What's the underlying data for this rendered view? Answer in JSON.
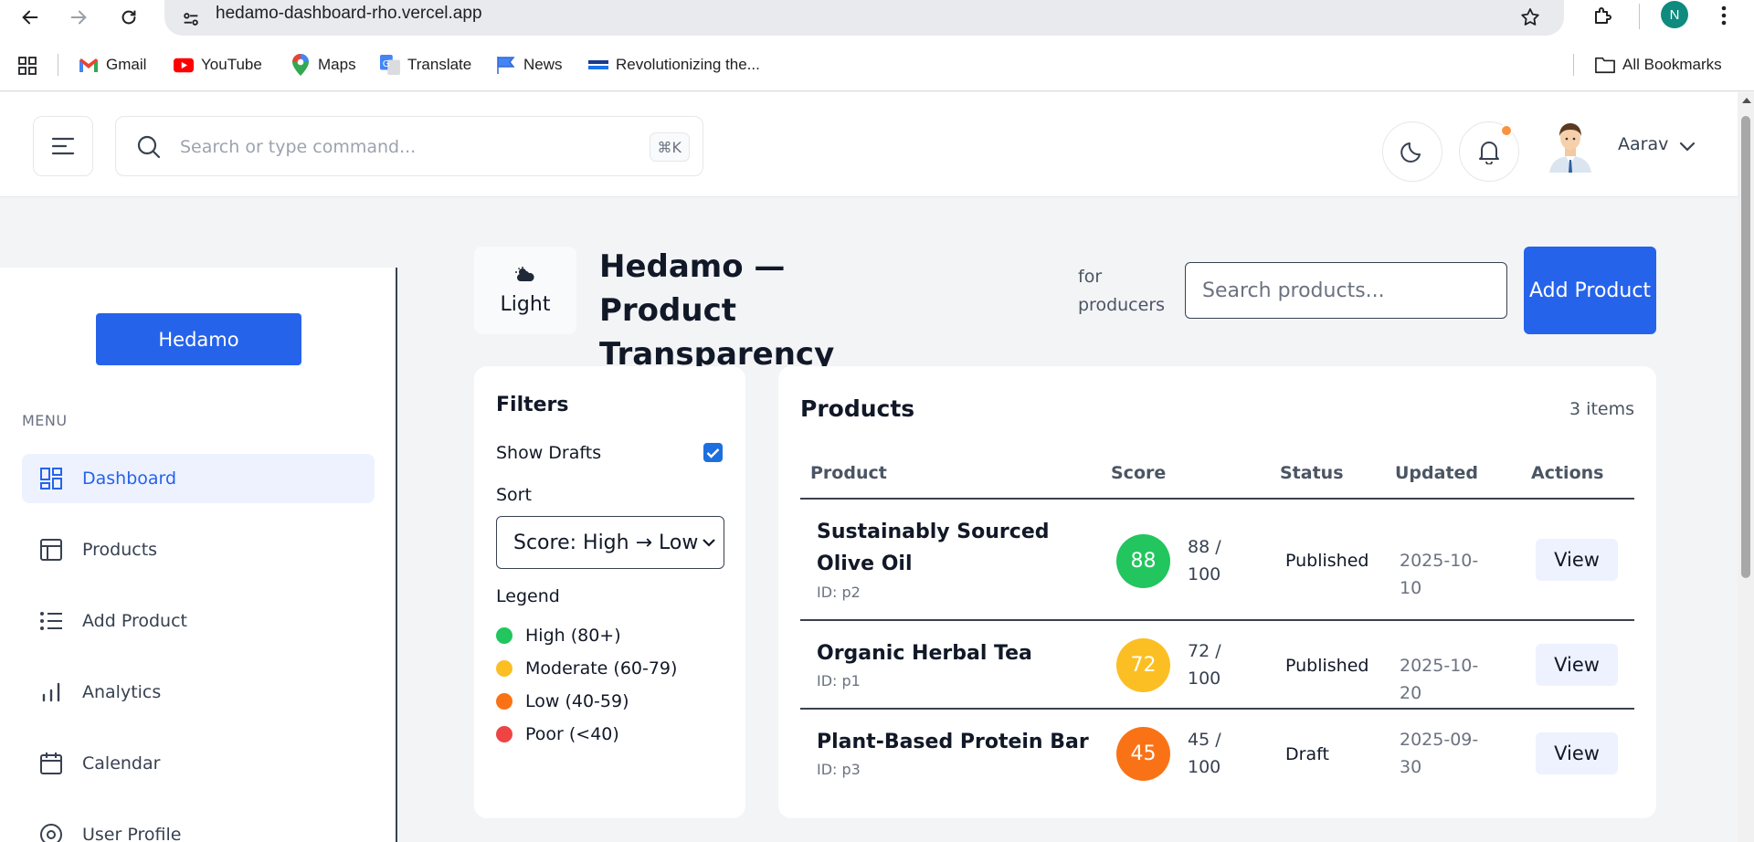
{
  "browser": {
    "url": "hedamo-dashboard-rho.vercel.app",
    "profile_initial": "N",
    "bookmarks": [
      {
        "label": "Gmail",
        "icon": "gmail-icon"
      },
      {
        "label": "YouTube",
        "icon": "youtube-icon"
      },
      {
        "label": "Maps",
        "icon": "maps-icon"
      },
      {
        "label": "Translate",
        "icon": "translate-icon"
      },
      {
        "label": "News",
        "icon": "news-icon"
      },
      {
        "label": "Revolutionizing the...",
        "icon": "site-icon"
      }
    ],
    "all_bookmarks": "All Bookmarks"
  },
  "header": {
    "search_placeholder": "Search or type command...",
    "shortcut": "⌘K",
    "user_name": "Aarav"
  },
  "sidebar": {
    "brand": "Hedamo",
    "menu_label": "MENU",
    "items": [
      {
        "label": "Dashboard",
        "icon": "dashboard-icon",
        "active": true
      },
      {
        "label": "Products",
        "icon": "products-icon"
      },
      {
        "label": "Add Product",
        "icon": "list-icon"
      },
      {
        "label": "Analytics",
        "icon": "analytics-icon"
      },
      {
        "label": "Calendar",
        "icon": "calendar-icon"
      },
      {
        "label": "User Profile",
        "icon": "user-profile-icon"
      }
    ]
  },
  "main": {
    "theme_toggle_label": "Light",
    "title": "Hedamo — Product Transparency",
    "subtitle": "for producers",
    "search_placeholder": "Search products...",
    "add_product_label": "Add Product"
  },
  "filters": {
    "title": "Filters",
    "show_drafts_label": "Show Drafts",
    "show_drafts_checked": true,
    "sort_label": "Sort",
    "sort_value": "Score: High → Low",
    "legend_label": "Legend",
    "legend": [
      {
        "label": "High (80+)",
        "color": "#22c55e"
      },
      {
        "label": "Moderate (60-79)",
        "color": "#fbbf24"
      },
      {
        "label": "Low (40-59)",
        "color": "#f97316"
      },
      {
        "label": "Poor (<40)",
        "color": "#ef4444"
      }
    ]
  },
  "products": {
    "title": "Products",
    "count": "3 items",
    "columns": [
      "Product",
      "Score",
      "Status",
      "Updated",
      "Actions"
    ],
    "rows": [
      {
        "name": "Sustainably Sourced Olive Oil",
        "id": "ID: p2",
        "score": "88",
        "score_text": "88 / 100",
        "score_color": "#22c55e",
        "status": "Published",
        "updated": "2025-10-10",
        "action": "View"
      },
      {
        "name": "Organic Herbal Tea",
        "id": "ID: p1",
        "score": "72",
        "score_text": "72 / 100",
        "score_color": "#fbbf24",
        "status": "Published",
        "updated": "2025-10-20",
        "action": "View"
      },
      {
        "name": "Plant-Based Protein Bar",
        "id": "ID: p3",
        "score": "45",
        "score_text": "45 / 100",
        "score_color": "#f97316",
        "status": "Draft",
        "updated": "2025-09-30",
        "action": "View"
      }
    ]
  }
}
